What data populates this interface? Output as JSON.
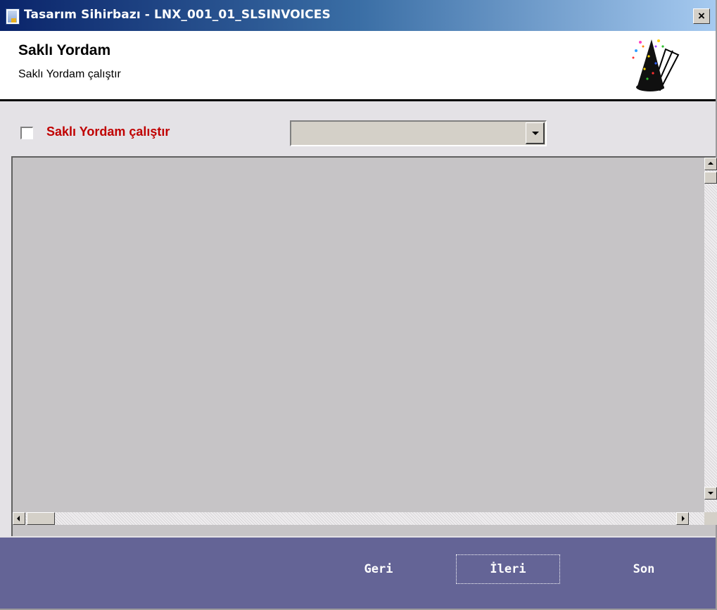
{
  "window": {
    "title": "Tasarım Sihirbazı - LNX_001_01_SLSINVOICES",
    "close_label": "×"
  },
  "header": {
    "title": "Saklı Yordam",
    "subtitle": "Saklı Yordam çalıştır",
    "icon": "wizard-hat-icon"
  },
  "options": {
    "checkbox_checked": false,
    "checkbox_label": "Saklı Yordam çalıştır",
    "dropdown_value": ""
  },
  "footer": {
    "back_label": "Geri",
    "next_label": "İleri",
    "finish_label": "Son"
  },
  "colors": {
    "title_gradient_start": "#0a246a",
    "title_gradient_end": "#a6caf0",
    "label_red": "#c00000",
    "footer_bg": "#646496",
    "grid_bg": "#c6c4c6"
  }
}
